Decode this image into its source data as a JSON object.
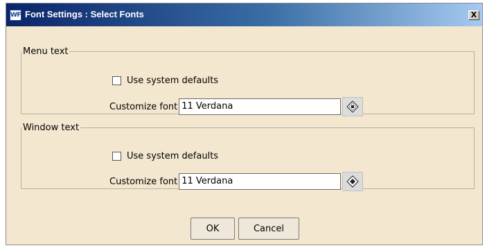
{
  "window": {
    "app_icon_text": "WF",
    "title": "Font Settings : Select Fonts",
    "close_glyph": "X"
  },
  "menu_text": {
    "legend": "Menu text",
    "use_system_defaults_label": "Use system defaults",
    "use_system_defaults_checked": false,
    "customize_label": "Customize font",
    "font_value": "11 Verdana",
    "font_picker_icon": "font-picker-icon"
  },
  "window_text": {
    "legend": "Window text",
    "use_system_defaults_label": "Use system defaults",
    "use_system_defaults_checked": false,
    "customize_label": "Customize font",
    "font_value": "11 Verdana",
    "font_picker_icon": "font-picker-icon"
  },
  "buttons": {
    "ok_label": "OK",
    "cancel_label": "Cancel"
  },
  "colors": {
    "dialog_background": "#f4e7cf",
    "titlebar_start": "#0a246a",
    "titlebar_end": "#a6caf0"
  }
}
